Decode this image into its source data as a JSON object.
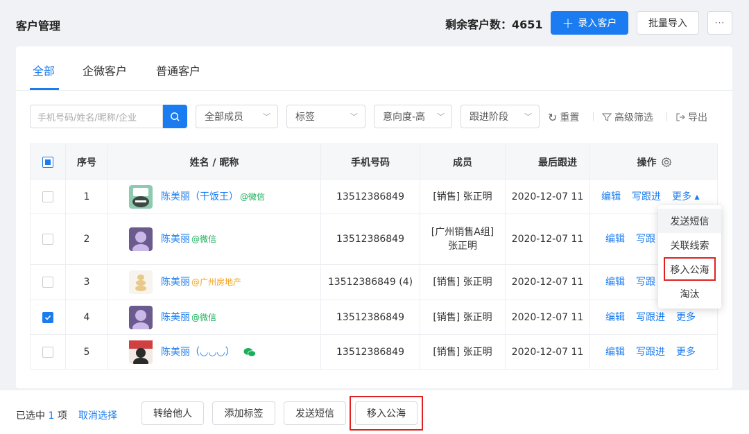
{
  "header": {
    "title": "客户管理",
    "remaining": "剩余客户数：4651",
    "add_button": "录入客户",
    "import_button": "批量导入",
    "more_button": "···"
  },
  "tabs": [
    {
      "label": "全部",
      "active": true
    },
    {
      "label": "企微客户",
      "active": false
    },
    {
      "label": "普通客户",
      "active": false
    }
  ],
  "filters": {
    "search_placeholder": "手机号码/姓名/昵称/企业",
    "member": "全部成员",
    "tag": "标签",
    "intent": "意向度-高",
    "stage": "跟进阶段",
    "reset": "重置",
    "advanced": "高级筛选",
    "export": "导出"
  },
  "table": {
    "headers": [
      "序号",
      "姓名 / 昵称",
      "手机号码",
      "成员",
      "最后跟进",
      "操作"
    ],
    "rows": [
      {
        "index": "1",
        "name": "陈美丽（干饭王）",
        "tag": "@微信",
        "tag_color": "#1aad5a",
        "phone": "13512386849",
        "member": "[销售] 张正明",
        "last": "2020-12-07 11",
        "checked": false,
        "op_more": "更多 ▴"
      },
      {
        "index": "2",
        "name": "陈美丽",
        "tag": "@微信",
        "tag_color": "#1aad5a",
        "phone": "13512386849",
        "member": "[广州销售A组] 张正明",
        "last": "2020-12-07 11",
        "checked": false,
        "op_more": ""
      },
      {
        "index": "3",
        "name": "陈美丽",
        "tag": "@广州房地产",
        "tag_color": "#f0a020",
        "phone": "13512386849 (4)",
        "member": "[销售] 张正明",
        "last": "2020-12-07 11",
        "checked": false,
        "op_more": ""
      },
      {
        "index": "4",
        "name": "陈美丽",
        "tag": "@微信",
        "tag_color": "#1aad5a",
        "phone": "13512386849",
        "member": "[销售] 张正明",
        "last": "2020-12-07 11",
        "checked": true,
        "op_more": "更多"
      },
      {
        "index": "5",
        "name": "陈美丽（◡◡◡）",
        "tag": "",
        "tag_color": "#1aad5a",
        "phone": "13512386849",
        "member": "[销售] 张正明",
        "last": "2020-12-07 11",
        "checked": false,
        "op_more": "更多"
      }
    ],
    "op_edit": "编辑",
    "op_follow": "写跟进",
    "op_follow_short": "写跟"
  },
  "dropdown": [
    "发送短信",
    "关联线索",
    "移入公海",
    "淘汰"
  ],
  "bottom": {
    "selected_prefix": "已选中",
    "selected_count": "1",
    "selected_suffix": "项",
    "cancel": "取消选择",
    "buttons": [
      "转给他人",
      "添加标签",
      "发送短信",
      "移入公海"
    ]
  },
  "colors": {
    "primary": "#1a7cf0",
    "highlight": "#e02020"
  }
}
